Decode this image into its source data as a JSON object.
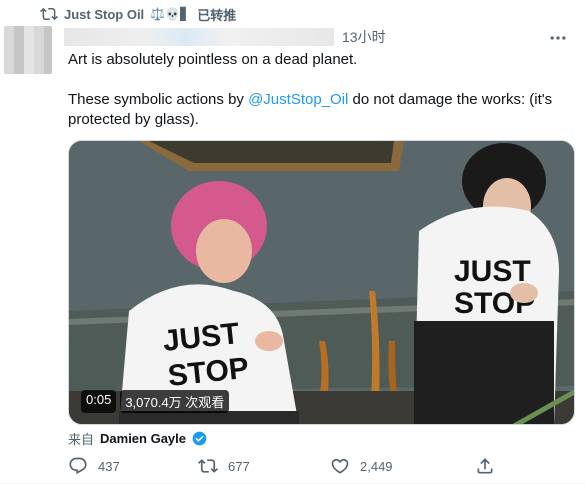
{
  "retweet": {
    "name": "Just Stop Oil",
    "emoji": "⚖️💀▋",
    "label": "已转推"
  },
  "tweet": {
    "time": "13小时",
    "text_line1": "Art is absolutely pointless on a dead planet.",
    "text_line2_pre": "These symbolic actions by ",
    "mention": "@JustStop_Oil",
    "text_line2_post": "  do not damage the works: (it's protected by glass).",
    "media": {
      "duration": "0:05",
      "views": "3,070.4万 次观看",
      "shirt_text_1": "JUST",
      "shirt_text_2": "STOP"
    },
    "from_prefix": "来自",
    "from_name": "Damien Gayle"
  },
  "actions": {
    "reply_count": "437",
    "retweet_count": "677",
    "like_count": "2,449"
  },
  "colors": {
    "accent": "#1d9bf0",
    "muted": "#536471",
    "text": "#0f1419"
  }
}
